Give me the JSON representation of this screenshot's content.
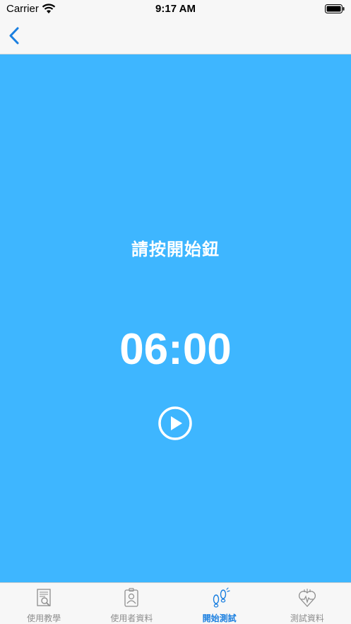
{
  "status_bar": {
    "carrier": "Carrier",
    "time": "9:17 AM"
  },
  "main": {
    "prompt": "請按開始鈕",
    "timer": "06:00"
  },
  "tabs": [
    {
      "label": "使用教學",
      "icon": "tutorial-icon",
      "active": false
    },
    {
      "label": "使用者資料",
      "icon": "user-card-icon",
      "active": false
    },
    {
      "label": "開始測試",
      "icon": "footsteps-icon",
      "active": true
    },
    {
      "label": "測試資料",
      "icon": "heart-data-icon",
      "active": false
    }
  ],
  "colors": {
    "accent": "#1a7fe0",
    "background": "#3eb6ff",
    "inactive": "#8e8e8e"
  }
}
